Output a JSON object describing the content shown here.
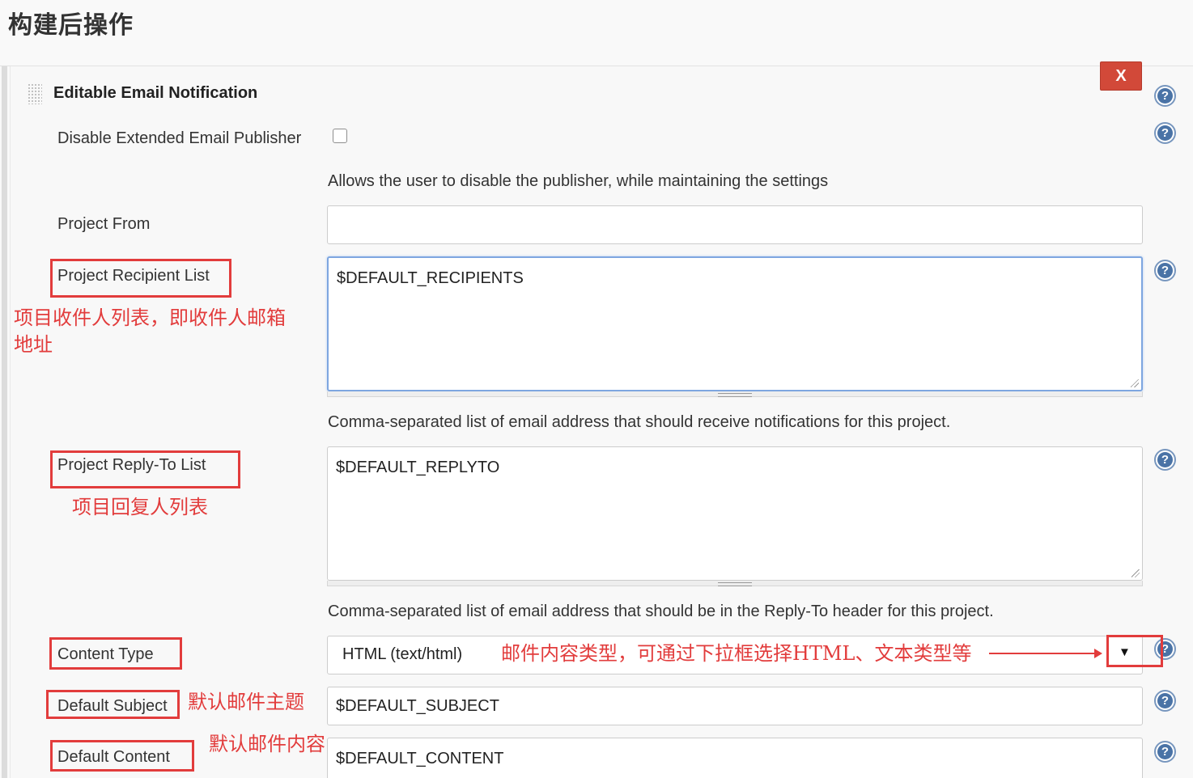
{
  "page": {
    "title": "构建后操作"
  },
  "section": {
    "title": "Editable Email Notification",
    "close_label": "X"
  },
  "fields": {
    "disable": {
      "label": "Disable Extended Email Publisher",
      "description": "Allows the user to disable the publisher, while maintaining the settings"
    },
    "project_from": {
      "label": "Project From",
      "value": ""
    },
    "recipients": {
      "label": "Project Recipient List",
      "value": "$DEFAULT_RECIPIENTS",
      "description": "Comma-separated list of email address that should receive notifications for this project."
    },
    "reply_to": {
      "label": "Project Reply-To List",
      "value": "$DEFAULT_REPLYTO",
      "description": "Comma-separated list of email address that should be in the Reply-To header for this project."
    },
    "content_type": {
      "label": "Content Type",
      "value": "HTML (text/html)"
    },
    "subject": {
      "label": "Default Subject",
      "value": "$DEFAULT_SUBJECT"
    },
    "content": {
      "label": "Default Content",
      "value": "$DEFAULT_CONTENT"
    }
  },
  "annotations": {
    "recipients_line1": "项目收件人列表，即收件人邮箱",
    "recipients_line2": "地址",
    "reply_to": "项目回复人列表",
    "content_type": "邮件内容类型，可通过下拉框选择HTML、文本类型等",
    "subject": "默认邮件主题",
    "content": "默认邮件内容"
  },
  "icons": {
    "help": "help-icon",
    "dropdown": "dropdown-arrow-icon",
    "grip": "drag-handle-icon"
  },
  "colors": {
    "annotation": "#e23c3c",
    "close_button": "#d24939",
    "help_icon": "#4a73a6",
    "focus_border": "#7ea6e0"
  }
}
